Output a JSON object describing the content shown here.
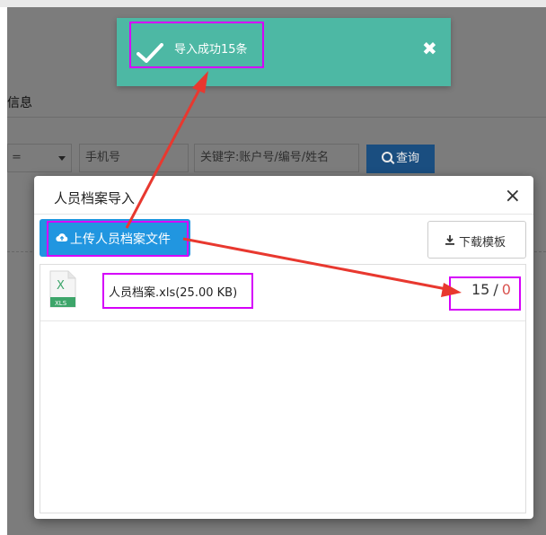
{
  "background": {
    "section_title": "信息",
    "select_value": "=",
    "phone_placeholder": "手机号",
    "keyword_placeholder": "关键字:账户号/编号/姓名",
    "search_label": "查询"
  },
  "toast": {
    "message": "导入成功15条",
    "close": "✖",
    "color": "#4db8a4"
  },
  "modal": {
    "title": "人员档案导入",
    "close": "×",
    "upload_label": "上传人员档案文件",
    "download_label": "下载模板",
    "file": {
      "icon_top": "X",
      "icon_tag": "XLS",
      "name": "人员档案.xls(25.00 KB)",
      "success": "15",
      "separator": "/",
      "failed": "0"
    }
  },
  "colors": {
    "upload_button": "#2196e0",
    "highlight": "#d500f9",
    "arrow": "#e8382f",
    "failed_count": "#d9534f"
  }
}
